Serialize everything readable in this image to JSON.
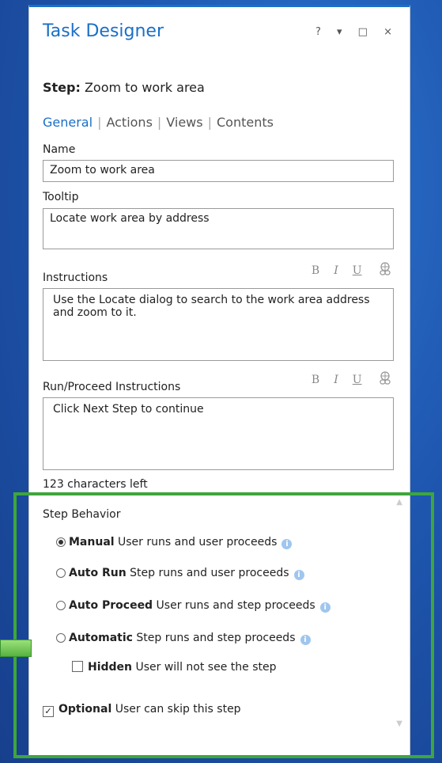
{
  "panel": {
    "title": "Task Designer",
    "controls": {
      "help": "?",
      "dropdown": "▾",
      "maximize": "□",
      "close": "×"
    }
  },
  "step": {
    "label": "Step:",
    "value": "Zoom to work area"
  },
  "tabs": [
    {
      "label": "General",
      "active": true
    },
    {
      "label": "Actions",
      "active": false
    },
    {
      "label": "Views",
      "active": false
    },
    {
      "label": "Contents",
      "active": false
    }
  ],
  "name": {
    "label": "Name",
    "value": "Zoom to work area"
  },
  "tooltip": {
    "label": "Tooltip",
    "value": "Locate work area by address"
  },
  "instructions": {
    "label": "Instructions",
    "value": "Use the Locate dialog to search to the work area address and zoom to it."
  },
  "run_proceed": {
    "label": "Run/Proceed Instructions",
    "value": "Click Next Step to continue"
  },
  "format": {
    "bold": "B",
    "italic": "I",
    "underline": "U"
  },
  "chars_left": "123 characters left",
  "behavior": {
    "label": "Step Behavior",
    "options": [
      {
        "name": "Manual",
        "desc": "User runs and user proceeds",
        "selected": true
      },
      {
        "name": "Auto Run",
        "desc": "Step runs and user proceeds",
        "selected": false
      },
      {
        "name": "Auto Proceed",
        "desc": "User runs and step proceeds",
        "selected": false
      },
      {
        "name": "Automatic",
        "desc": "Step runs and step proceeds",
        "selected": false
      }
    ],
    "hidden": {
      "name": "Hidden",
      "desc": "User will not see the step",
      "checked": false
    },
    "optional": {
      "name": "Optional",
      "desc": "User can skip this step",
      "checked": true
    }
  },
  "colors": {
    "accent": "#1a6fc7",
    "highlight": "#3ea63c",
    "background": "#1f56ad"
  }
}
